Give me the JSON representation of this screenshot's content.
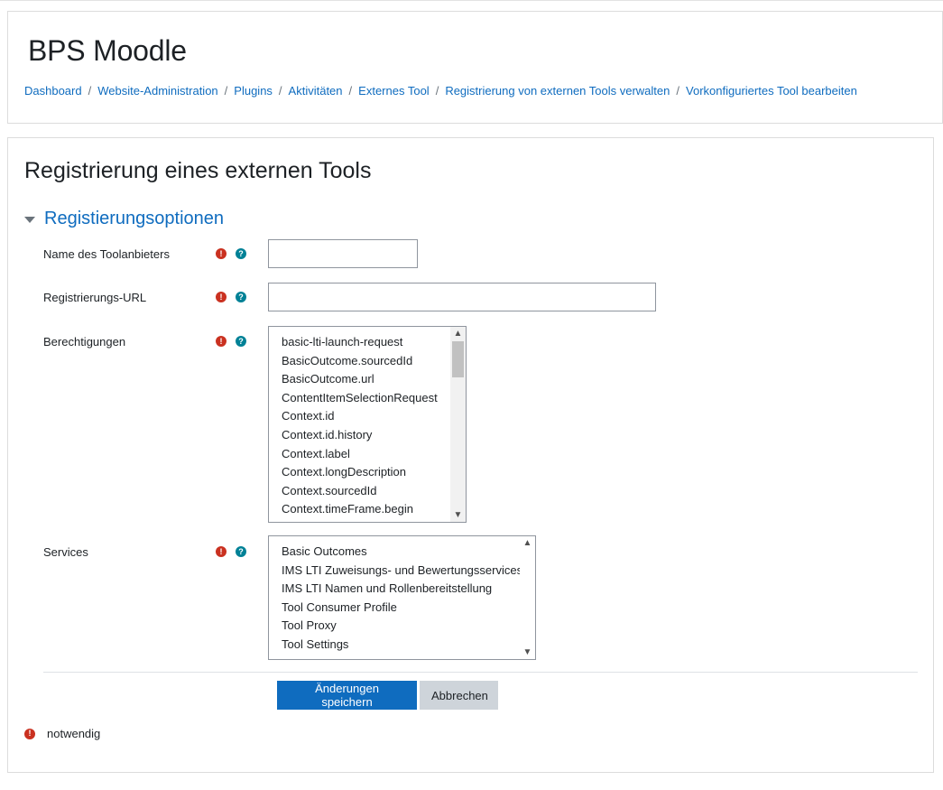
{
  "header": {
    "site_title": "BPS Moodle",
    "breadcrumb": [
      "Dashboard",
      "Website-Administration",
      "Plugins",
      "Aktivitäten",
      "Externes Tool",
      "Registrierung von externen Tools verwalten",
      "Vorkonfiguriertes Tool bearbeiten"
    ],
    "breadcrumb_separator": "/"
  },
  "main": {
    "page_heading": "Registrierung eines externen Tools",
    "section_title": "Registierungsoptionen",
    "fields": {
      "tool_provider_name": {
        "label": "Name des Toolanbieters",
        "value": ""
      },
      "registration_url": {
        "label": "Registrierungs-URL",
        "value": ""
      },
      "capabilities": {
        "label": "Berechtigungen",
        "options": [
          "basic-lti-launch-request",
          "BasicOutcome.sourcedId",
          "BasicOutcome.url",
          "ContentItemSelectionRequest",
          "Context.id",
          "Context.id.history",
          "Context.label",
          "Context.longDescription",
          "Context.sourcedId",
          "Context.timeFrame.begin"
        ]
      },
      "services": {
        "label": "Services",
        "options": [
          "Basic Outcomes",
          "IMS LTI Zuweisungs- und Bewertungsservices",
          "IMS LTI Namen und Rollenbereitstellung",
          "Tool Consumer Profile",
          "Tool Proxy",
          "Tool Settings"
        ]
      }
    },
    "icons": {
      "required": "exclamation-circle-icon",
      "help": "question-circle-icon"
    },
    "buttons": {
      "save_label": "Änderungen speichern",
      "cancel_label": "Abbrechen"
    },
    "required_note": "notwendig"
  },
  "colors": {
    "link": "#0f6cbf",
    "primary": "#0f6cbf",
    "required": "#ca3120",
    "help": "#008196",
    "secondary_button": "#ced4da"
  }
}
